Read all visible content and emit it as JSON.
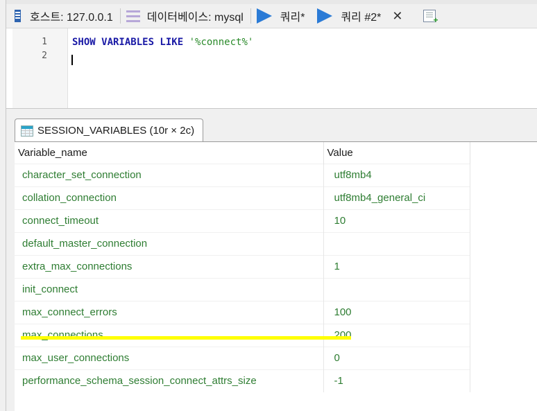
{
  "tabs": [
    {
      "label": "호스트: 127.0.0.1",
      "icon": "server-icon"
    },
    {
      "label": "데이터베이스: mysql",
      "icon": "database-icon"
    },
    {
      "label": "쿼리*",
      "icon": "play-icon"
    },
    {
      "label": "쿼리 #2*",
      "icon": "play-icon"
    }
  ],
  "editor": {
    "line_numbers": [
      "1",
      "2"
    ],
    "line1": {
      "keywords": "SHOW VARIABLES LIKE",
      "string": "'%connect%'"
    }
  },
  "result": {
    "tab_label": "SESSION_VARIABLES (10r × 2c)",
    "columns": [
      "Variable_name",
      "Value"
    ],
    "rows": [
      [
        "character_set_connection",
        "utf8mb4"
      ],
      [
        "collation_connection",
        "utf8mb4_general_ci"
      ],
      [
        "connect_timeout",
        "10"
      ],
      [
        "default_master_connection",
        ""
      ],
      [
        "extra_max_connections",
        "1"
      ],
      [
        "init_connect",
        ""
      ],
      [
        "max_connect_errors",
        "100"
      ],
      [
        "max_connections",
        "200"
      ],
      [
        "max_user_connections",
        "0"
      ],
      [
        "performance_schema_session_connect_attrs_size",
        "-1"
      ]
    ]
  },
  "colors": {
    "keyword": "#1a1aa6",
    "string": "#2a8a2a",
    "cell_text": "#2e7d32",
    "highlight": "#ffff00",
    "play": "#2b7bd6"
  }
}
